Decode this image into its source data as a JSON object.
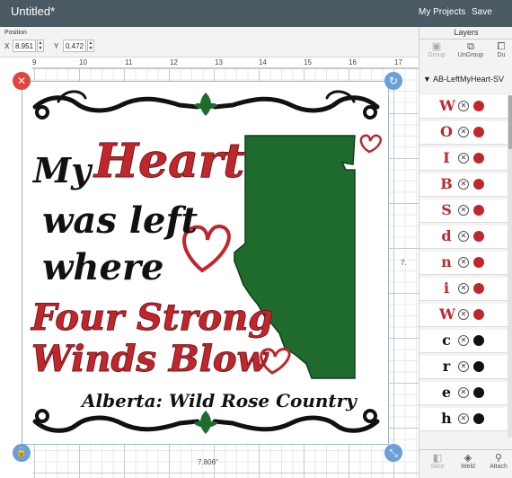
{
  "app": {
    "title": "Untitled*",
    "my_projects": "My Projects",
    "save": "Save"
  },
  "position": {
    "label": "Position",
    "x_label": "X",
    "x_value": "8.951",
    "y_label": "Y",
    "y_value": "0.472"
  },
  "ruler": {
    "ticks": [
      "9",
      "10",
      "11",
      "12",
      "13",
      "14",
      "15",
      "16",
      "17"
    ]
  },
  "canvas": {
    "width_label": "7.806\"",
    "height_label": "7."
  },
  "design": {
    "line1_a": "My",
    "line1_b": "Heart",
    "line2": "was left",
    "line3": "where",
    "line4": "Four Strong",
    "line5": "Winds Blow",
    "footer": "Alberta: Wild Rose Country",
    "colors": {
      "red": "#c0272d",
      "green": "#1f6b2e",
      "black": "#111111"
    }
  },
  "layers_panel": {
    "header": "Layers",
    "tools": [
      {
        "label": "Group",
        "icon": "group-icon",
        "enabled": false
      },
      {
        "label": "UnGroup",
        "icon": "ungroup-icon",
        "enabled": true
      },
      {
        "label": "Du",
        "icon": "duplicate-icon",
        "enabled": true
      }
    ],
    "group_name": "AB-LeftMyHeart-SV",
    "items": [
      {
        "glyph": "W",
        "color": "#c0272d"
      },
      {
        "glyph": "O",
        "color": "#c0272d"
      },
      {
        "glyph": "I",
        "color": "#c0272d"
      },
      {
        "glyph": "B",
        "color": "#c0272d"
      },
      {
        "glyph": "S",
        "color": "#c0272d"
      },
      {
        "glyph": "d",
        "color": "#c0272d"
      },
      {
        "glyph": "n",
        "color": "#c0272d"
      },
      {
        "glyph": "i",
        "color": "#c0272d"
      },
      {
        "glyph": "W",
        "color": "#c0272d"
      },
      {
        "glyph": "c",
        "color": "#111111"
      },
      {
        "glyph": "r",
        "color": "#111111"
      },
      {
        "glyph": "e",
        "color": "#111111"
      },
      {
        "glyph": "h",
        "color": "#111111"
      }
    ],
    "bottom_tools": [
      {
        "label": "Slice",
        "icon": "slice-icon",
        "enabled": false
      },
      {
        "label": "Weld",
        "icon": "weld-icon",
        "enabled": true
      },
      {
        "label": "Attach",
        "icon": "attach-icon",
        "enabled": true
      }
    ]
  }
}
